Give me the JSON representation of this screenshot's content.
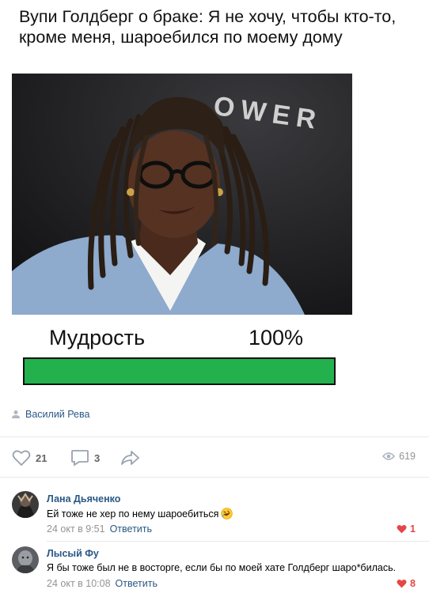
{
  "meme": {
    "caption": "Вупи Голдберг о браке: Я не хочу, чтобы кто-то, кроме меня, шароебился по моему дому",
    "wisdom_label": "Мудрость",
    "wisdom_value": "100%",
    "wisdom_fraction": 1.0,
    "bar_color": "#22b14c",
    "photo_background_text": "OWER"
  },
  "post": {
    "author": "Василий Рева",
    "likes": "21",
    "comments": "3",
    "views": "619"
  },
  "comments": [
    {
      "name": "Лана Дьяченко",
      "text": "Ей тоже не хер по нему шароебиться",
      "emoji": "rofl-emoji",
      "time": "24 окт в 9:51",
      "reply_label": "Ответить",
      "likes": "1"
    },
    {
      "name": "Лысый Фу",
      "text": "Я бы тоже был не в восторге, если бы по моей хате Голдберг шаро*билась.",
      "time": "24 окт в 10:08",
      "reply_label": "Ответить",
      "likes": "8"
    }
  ],
  "colors": {
    "link": "#2a5885",
    "muted": "#939393",
    "like_red": "#e64646"
  }
}
